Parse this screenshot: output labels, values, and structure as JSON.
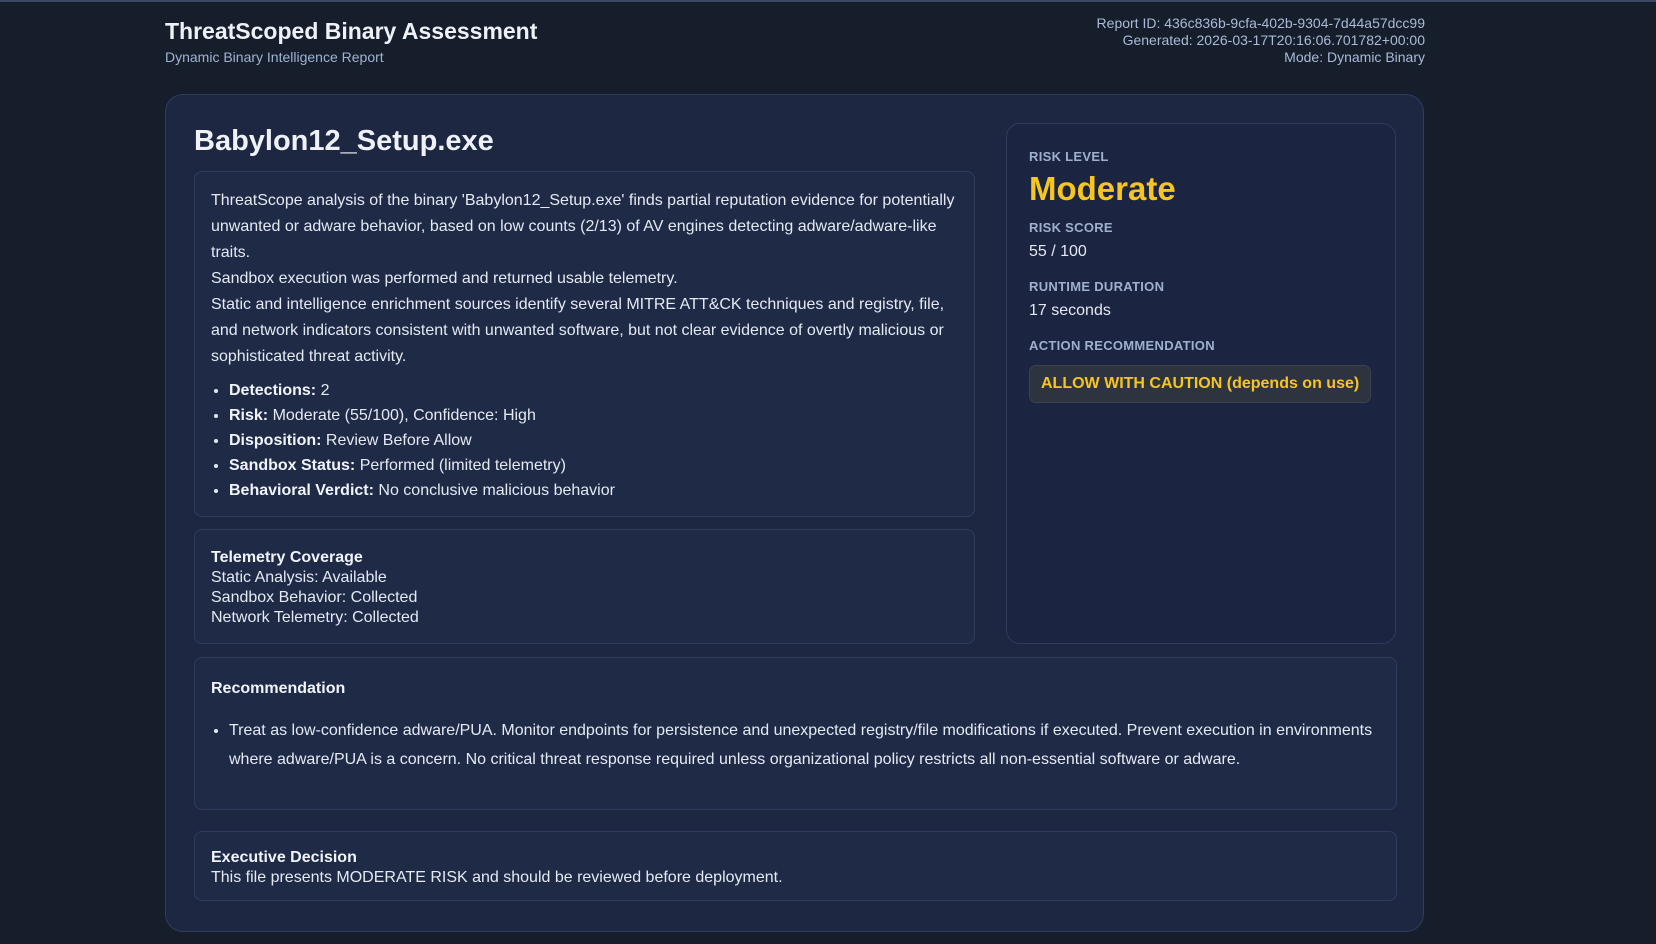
{
  "header": {
    "title": "ThreatScoped Binary Assessment",
    "subtitle": "Dynamic Binary Intelligence Report",
    "report_id": "Report ID: 436c836b-9cfa-402b-9304-7d44a57dcc99",
    "generated": "Generated: 2026-03-17T20:16:06.701782+00:00",
    "mode": "Mode: Dynamic Binary"
  },
  "file": {
    "name": "Babylon12_Setup.exe"
  },
  "summary": {
    "paragraphs": [
      "ThreatScope analysis of the binary 'Babylon12_Setup.exe' finds partial reputation evidence for potentially unwanted or adware behavior, based on low counts (2/13) of AV engines detecting adware/adware-like traits.",
      "Sandbox execution was performed and returned usable telemetry.",
      "Static and intelligence enrichment sources identify several MITRE ATT&CK techniques and registry, file, and network indicators consistent with unwanted software, but not clear evidence of overtly malicious or sophisticated threat activity."
    ],
    "facts": [
      {
        "label": "Detections:",
        "value": "2"
      },
      {
        "label": "Risk:",
        "value": "Moderate (55/100), Confidence: High"
      },
      {
        "label": "Disposition:",
        "value": "Review Before Allow"
      },
      {
        "label": "Sandbox Status:",
        "value": "Performed (limited telemetry)"
      },
      {
        "label": "Behavioral Verdict:",
        "value": "No conclusive malicious behavior"
      }
    ]
  },
  "telemetry": {
    "title": "Telemetry Coverage",
    "lines": [
      "Static Analysis: Available",
      "Sandbox Behavior: Collected",
      "Network Telemetry: Collected"
    ]
  },
  "risk": {
    "level_label": "RISK LEVEL",
    "level": "Moderate",
    "score_label": "RISK SCORE",
    "score": "55 / 100",
    "runtime_label": "RUNTIME DURATION",
    "runtime": "17 seconds",
    "action_label": "ACTION RECOMMENDATION",
    "action": "ALLOW WITH CAUTION (depends on use)"
  },
  "recommendation": {
    "title": "Recommendation",
    "items": [
      "Treat as low-confidence adware/PUA. Monitor endpoints for persistence and unexpected registry/file modifications if executed. Prevent execution in environments where adware/PUA is a concern. No critical threat response required unless organizational policy restricts all non-essential software or adware."
    ]
  },
  "executive": {
    "title": "Executive Decision",
    "text": "This file presents MODERATE RISK and should be reviewed before deployment."
  },
  "colors": {
    "background": "#161d2b",
    "card": "#1d2741",
    "accent_warning": "#f6c522"
  }
}
